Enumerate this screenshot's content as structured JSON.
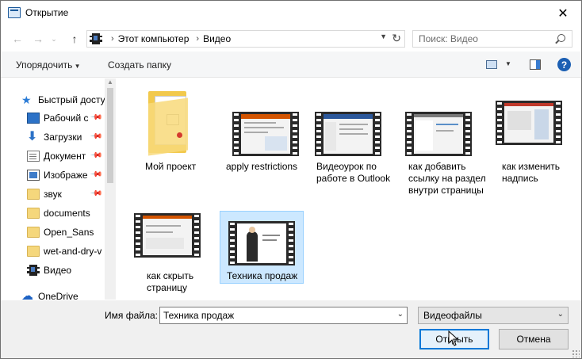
{
  "window": {
    "title": "Открытие"
  },
  "nav": {
    "address": [
      "Этот компьютер",
      "Видео"
    ],
    "search_placeholder": "Поиск: Видео"
  },
  "toolbar": {
    "organize": "Упорядочить",
    "new_folder": "Создать папку"
  },
  "sidebar": {
    "items": [
      {
        "label": "Быстрый досту",
        "icon": "star-icon",
        "pinned": false
      },
      {
        "label": "Рабочий с",
        "icon": "desktop-icon",
        "pinned": true
      },
      {
        "label": "Загрузки",
        "icon": "download-icon",
        "pinned": true
      },
      {
        "label": "Документ",
        "icon": "documents-icon",
        "pinned": true
      },
      {
        "label": "Изображе",
        "icon": "images-icon",
        "pinned": true
      },
      {
        "label": "звук",
        "icon": "folder-icon",
        "pinned": true
      },
      {
        "label": "documents",
        "icon": "folder-icon",
        "pinned": false
      },
      {
        "label": "Open_Sans",
        "icon": "folder-icon",
        "pinned": false
      },
      {
        "label": "wet-and-dry-v",
        "icon": "folder-icon",
        "pinned": false
      },
      {
        "label": "Видео",
        "icon": "video-folder-icon",
        "pinned": false
      },
      {
        "label": "OneDrive",
        "icon": "cloud-icon",
        "pinned": false
      }
    ]
  },
  "files": [
    {
      "label": "Мой проект",
      "type": "folder"
    },
    {
      "label": "apply restrictions",
      "type": "video"
    },
    {
      "label": "Видеоурок по работе в Outlook",
      "type": "video"
    },
    {
      "label": "как добавить ссылку на раздел внутри страницы",
      "type": "video"
    },
    {
      "label": "как изменить надпись",
      "type": "video"
    },
    {
      "label": "как скрыть страницу",
      "type": "video"
    },
    {
      "label": "Техника продаж",
      "type": "video",
      "selected": true
    }
  ],
  "footer": {
    "filename_label": "Имя файла:",
    "filename_value": "Техника продаж",
    "filetype": "Видеофайлы",
    "open": "Открыть",
    "cancel": "Отмена"
  },
  "colors": {
    "accent": "#0078d7",
    "selection": "#cce8ff"
  }
}
